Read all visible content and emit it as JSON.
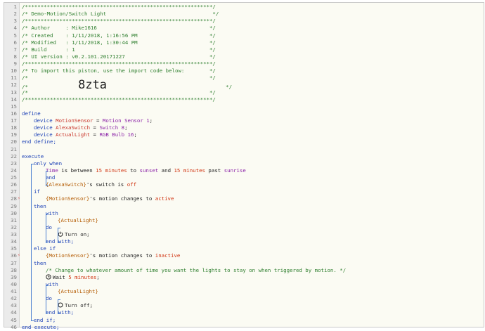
{
  "lines": [
    {
      "n": "1",
      "tokens": [
        {
          "t": "/************************************************************/",
          "c": "comment"
        }
      ]
    },
    {
      "n": "2",
      "tokens": [
        {
          "t": "/* Demo-Motion/Switch Light                                  */",
          "c": "comment"
        }
      ]
    },
    {
      "n": "3",
      "tokens": [
        {
          "t": "/************************************************************/",
          "c": "comment"
        }
      ]
    },
    {
      "n": "4",
      "tokens": [
        {
          "t": "/* Author     : Mike1616                                    */",
          "c": "comment"
        }
      ]
    },
    {
      "n": "5",
      "tokens": [
        {
          "t": "/* Created    : 1/11/2018, 1:16:56 PM                       */",
          "c": "comment"
        }
      ]
    },
    {
      "n": "6",
      "tokens": [
        {
          "t": "/* Modified   : 1/11/2018, 1:30:44 PM                       */",
          "c": "comment"
        }
      ]
    },
    {
      "n": "7",
      "tokens": [
        {
          "t": "/* Build      : 1                                           */",
          "c": "comment"
        }
      ]
    },
    {
      "n": "8",
      "tokens": [
        {
          "t": "/* UI version : v0.2.101.20171227                           */",
          "c": "comment"
        }
      ]
    },
    {
      "n": "9",
      "tokens": [
        {
          "t": "/************************************************************/",
          "c": "comment"
        }
      ]
    },
    {
      "n": "10",
      "tokens": [
        {
          "t": "/* To import this piston, use the import code below:        */",
          "c": "comment"
        }
      ]
    },
    {
      "n": "11",
      "tokens": [
        {
          "t": "/*                                                          */",
          "c": "comment"
        }
      ]
    },
    {
      "n": "12",
      "tokens": [
        {
          "t": "/*                ",
          "c": "comment"
        },
        {
          "t": "8zta",
          "c": "big"
        },
        {
          "t": "                                      */",
          "c": "comment"
        }
      ]
    },
    {
      "n": "13",
      "tokens": [
        {
          "t": "/*                                                          */",
          "c": "comment"
        }
      ]
    },
    {
      "n": "14",
      "tokens": [
        {
          "t": "/************************************************************/",
          "c": "comment"
        }
      ]
    },
    {
      "n": "15",
      "tokens": []
    },
    {
      "n": "16",
      "tokens": [
        {
          "t": "define",
          "c": "kw"
        }
      ]
    },
    {
      "n": "17",
      "indent": 1,
      "tokens": [
        {
          "t": "device ",
          "c": "kw"
        },
        {
          "t": "MotionSensor",
          "c": "var"
        },
        {
          "t": " = ",
          "c": "text"
        },
        {
          "t": "Motion Sensor 1",
          "c": "dev"
        },
        {
          "t": ";",
          "c": "text"
        }
      ]
    },
    {
      "n": "18",
      "indent": 1,
      "tokens": [
        {
          "t": "device ",
          "c": "kw"
        },
        {
          "t": "AlexaSwitch",
          "c": "var"
        },
        {
          "t": " = ",
          "c": "text"
        },
        {
          "t": "Switch 8",
          "c": "dev"
        },
        {
          "t": ";",
          "c": "text"
        }
      ]
    },
    {
      "n": "19",
      "indent": 1,
      "tokens": [
        {
          "t": "device ",
          "c": "kw"
        },
        {
          "t": "ActualLight",
          "c": "var"
        },
        {
          "t": " = ",
          "c": "text"
        },
        {
          "t": "RGB Bulb 16",
          "c": "dev"
        },
        {
          "t": ";",
          "c": "text"
        }
      ]
    },
    {
      "n": "20",
      "tokens": [
        {
          "t": "end define;",
          "c": "kw"
        }
      ]
    },
    {
      "n": "21",
      "tokens": []
    },
    {
      "n": "22",
      "tokens": [
        {
          "t": "execute",
          "c": "kw"
        }
      ]
    },
    {
      "n": "23",
      "indent": 1,
      "tokens": [
        {
          "t": "only when",
          "c": "kw"
        }
      ]
    },
    {
      "n": "24",
      "indent": 2,
      "tokens": [
        {
          "t": "Time",
          "c": "dev"
        },
        {
          "t": " is between ",
          "c": "text"
        },
        {
          "t": "15 minutes",
          "c": "num"
        },
        {
          "t": " to ",
          "c": "text"
        },
        {
          "t": "sunset",
          "c": "dev"
        },
        {
          "t": " and ",
          "c": "text"
        },
        {
          "t": "15 minutes",
          "c": "num"
        },
        {
          "t": " past ",
          "c": "text"
        },
        {
          "t": "sunrise",
          "c": "dev"
        }
      ]
    },
    {
      "n": "25",
      "indent": 2,
      "tokens": [
        {
          "t": "and",
          "c": "kw"
        }
      ]
    },
    {
      "n": "26",
      "indent": 2,
      "tokens": [
        {
          "t": "{AlexaSwitch}",
          "c": "val"
        },
        {
          "t": "'s switch is ",
          "c": "text"
        },
        {
          "t": "off",
          "c": "num"
        }
      ]
    },
    {
      "n": "27",
      "indent": 1,
      "tokens": [
        {
          "t": "if",
          "c": "kw"
        }
      ]
    },
    {
      "n": "28",
      "mark": "⚡",
      "indent": 2,
      "tokens": [
        {
          "t": "{MotionSensor}",
          "c": "val"
        },
        {
          "t": "'s motion changes to ",
          "c": "text"
        },
        {
          "t": "active",
          "c": "num"
        }
      ]
    },
    {
      "n": "29",
      "indent": 1,
      "tokens": [
        {
          "t": "then",
          "c": "kw"
        }
      ]
    },
    {
      "n": "30",
      "indent": 2,
      "tokens": [
        {
          "t": "with",
          "c": "kw"
        }
      ]
    },
    {
      "n": "31",
      "indent": 3,
      "tokens": [
        {
          "t": "{ActualLight}",
          "c": "val"
        }
      ]
    },
    {
      "n": "32",
      "indent": 2,
      "tokens": [
        {
          "t": "do",
          "c": "kw"
        }
      ]
    },
    {
      "n": "33",
      "indent": 3,
      "icon": "power-icon",
      "tokens": [
        {
          "t": "Turn on;",
          "c": "text"
        }
      ]
    },
    {
      "n": "34",
      "indent": 2,
      "tokens": [
        {
          "t": "end with;",
          "c": "kw"
        }
      ]
    },
    {
      "n": "35",
      "indent": 1,
      "tokens": [
        {
          "t": "else if",
          "c": "kw"
        }
      ]
    },
    {
      "n": "36",
      "mark": "⚡",
      "indent": 2,
      "tokens": [
        {
          "t": "{MotionSensor}",
          "c": "val"
        },
        {
          "t": "'s motion changes to ",
          "c": "text"
        },
        {
          "t": "inactive",
          "c": "num"
        }
      ]
    },
    {
      "n": "37",
      "indent": 1,
      "tokens": [
        {
          "t": "then",
          "c": "kw"
        }
      ]
    },
    {
      "n": "38",
      "indent": 2,
      "tokens": [
        {
          "t": "/* Change to whatever amount of time you want the lights to stay on when triggered by motion. */",
          "c": "comment"
        }
      ]
    },
    {
      "n": "39",
      "indent": 2,
      "icon": "clock-icon",
      "tokens": [
        {
          "t": "Wait ",
          "c": "text"
        },
        {
          "t": "5 minutes",
          "c": "num"
        },
        {
          "t": ";",
          "c": "text"
        }
      ]
    },
    {
      "n": "40",
      "indent": 2,
      "tokens": [
        {
          "t": "with",
          "c": "kw"
        }
      ]
    },
    {
      "n": "41",
      "indent": 3,
      "tokens": [
        {
          "t": "{ActualLight}",
          "c": "val"
        }
      ]
    },
    {
      "n": "42",
      "indent": 2,
      "tokens": [
        {
          "t": "do",
          "c": "kw"
        }
      ]
    },
    {
      "n": "43",
      "indent": 3,
      "icon": "circle-icon",
      "tokens": [
        {
          "t": "Turn off;",
          "c": "text"
        }
      ]
    },
    {
      "n": "44",
      "indent": 2,
      "tokens": [
        {
          "t": "end with;",
          "c": "kw"
        }
      ]
    },
    {
      "n": "45",
      "indent": 1,
      "tokens": [
        {
          "t": "end if;",
          "c": "kw"
        }
      ]
    },
    {
      "n": "46",
      "tokens": [
        {
          "t": "end execute;",
          "c": "kw"
        }
      ]
    }
  ]
}
